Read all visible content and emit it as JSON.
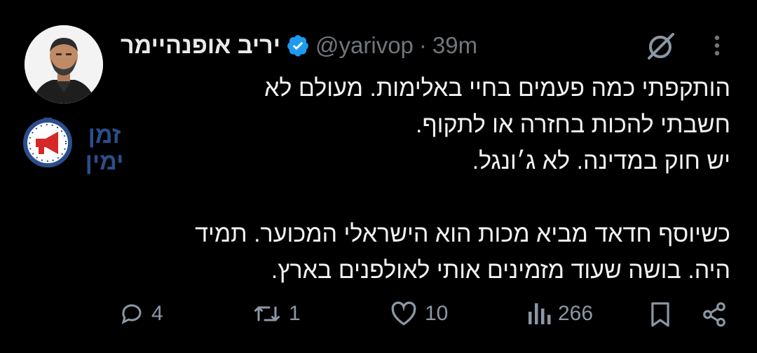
{
  "author": {
    "display_name": "יריב אופנהיימר",
    "handle": "@yarivop",
    "separator": "·",
    "time": "39m"
  },
  "tweet_lines": [
    "הותקפתי כמה פעמים בחיי באלימות. מעולם לא",
    "חשבתי להכות בחזרה או לתקוף.",
    "יש חוק במדינה. לא ג׳ונגל.",
    "",
    "כשיוסף חדאד מביא מכות הוא הישראלי המכוער. תמיד",
    "היה. בושה שעוד מזמינים אותי לאולפנים בארץ."
  ],
  "watermark": {
    "text_top": "זמן",
    "text_bottom": "ימין"
  },
  "actions": {
    "replies": "4",
    "reposts": "1",
    "likes": "10",
    "views": "266"
  },
  "colors": {
    "background": "#000000",
    "text": "#e7e9ea",
    "secondary": "#71767b",
    "verified": "#1d9bf0",
    "watermark_blue": "#2b4e8c",
    "watermark_red": "#d62828"
  }
}
